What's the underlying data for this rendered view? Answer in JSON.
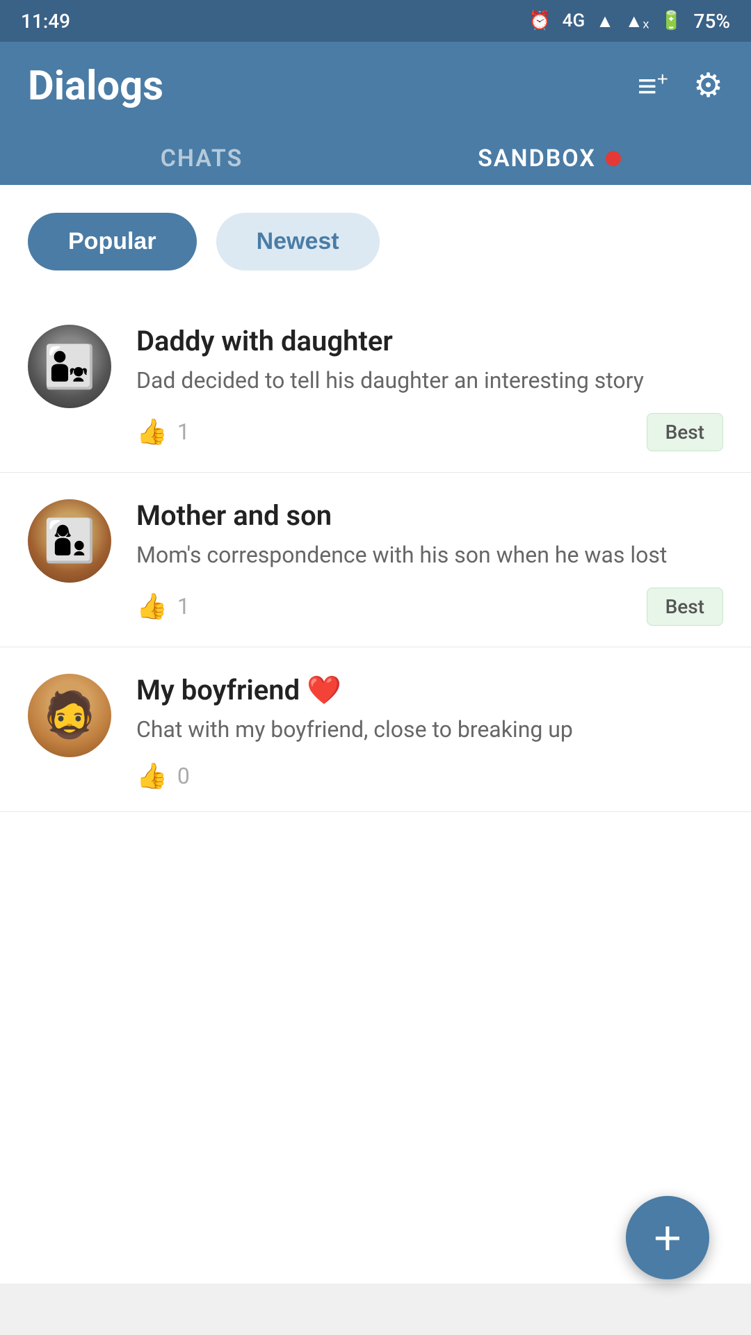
{
  "statusBar": {
    "time": "11:49",
    "battery": "75%",
    "network": "4G"
  },
  "header": {
    "title": "Dialogs",
    "addIcon": "≡+",
    "settingsIcon": "⚙"
  },
  "tabs": [
    {
      "id": "chats",
      "label": "CHATS",
      "active": false
    },
    {
      "id": "sandbox",
      "label": "SANDBOX",
      "active": true,
      "hasDot": true
    }
  ],
  "filters": [
    {
      "id": "popular",
      "label": "Popular",
      "active": true
    },
    {
      "id": "newest",
      "label": "Newest",
      "active": false
    }
  ],
  "chats": [
    {
      "id": "daddy-daughter",
      "title": "Daddy with daughter",
      "description": "Dad decided to tell his daughter an interesting story",
      "likes": 1,
      "badge": "Best"
    },
    {
      "id": "mother-son",
      "title": "Mother and son",
      "description": "Mom's correspondence with his son when he was lost",
      "likes": 1,
      "badge": "Best"
    },
    {
      "id": "my-boyfriend",
      "title": "My boyfriend",
      "titleSuffix": "❤️",
      "description": "Chat with my boyfriend, close to breaking up",
      "likes": 0,
      "badge": null
    }
  ],
  "fab": {
    "label": "+"
  }
}
